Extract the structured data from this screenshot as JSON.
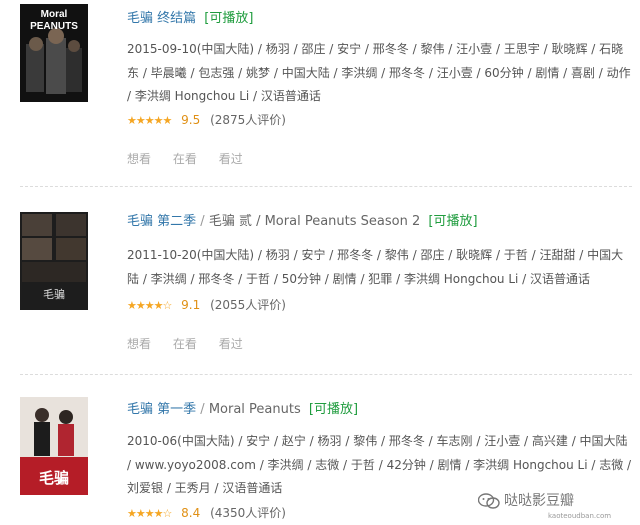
{
  "items": [
    {
      "title": "毛骗 终结篇",
      "alt_title": "",
      "play": "[可播放]",
      "poster_text": [
        "Moral",
        "PEANUTS"
      ],
      "meta": "2015-09-10(中国大陆) / 杨羽 / 邵庄 / 安宁 / 邢冬冬 / 黎伟 / 汪小壹 / 王思宇 / 耿晓辉 / 石晓东 / 毕晨曦 / 包志强 / 姚梦 / 中国大陆 / 李洪绸 / 邢冬冬 / 汪小壹 / 60分钟 / 剧情 / 喜剧 / 动作 / 李洪绸 Hongchou Li / 汉语普通话",
      "stars": "★★★★★",
      "rating": "9.5",
      "count": "(2875人评价)",
      "actions": [
        "想看",
        "在看",
        "看过"
      ]
    },
    {
      "title": "毛骗 第二季",
      "alt_title": "毛骗 贰 / Moral Peanuts Season 2",
      "play": "[可播放]",
      "poster_text": [
        "毛骗"
      ],
      "meta": "2011-10-20(中国大陆) / 杨羽 / 安宁 / 邢冬冬 / 黎伟 / 邵庄 / 耿晓辉 / 于哲 / 汪甜甜 / 中国大陆 / 李洪绸 / 邢冬冬 / 于哲 / 50分钟 / 剧情 / 犯罪 / 李洪绸 Hongchou Li / 汉语普通话",
      "stars": "★★★★☆",
      "rating": "9.1",
      "count": "(2055人评价)",
      "actions": [
        "想看",
        "在看",
        "看过"
      ]
    },
    {
      "title": "毛骗 第一季",
      "alt_title": "Moral Peanuts",
      "play": "[可播放]",
      "poster_text": [
        "毛骗"
      ],
      "meta": "2010-06(中国大陆) / 安宁 / 赵宁 / 杨羽 / 黎伟 / 邢冬冬 / 车志刚 / 汪小壹 / 高兴建 / 中国大陆 / www.yoyo2008.com / 李洪绸 / 志微 / 于哲 / 42分钟 / 剧情 / 李洪绸 Hongchou Li / 志微 / 刘爱银 / 王秀月 / 汉语普通话",
      "stars": "★★★★☆",
      "rating": "8.4",
      "count": "(4350人评价)",
      "actions": []
    }
  ],
  "watermark": {
    "text": "哒哒影豆瓣",
    "sub": "kaoteoudban.com"
  }
}
